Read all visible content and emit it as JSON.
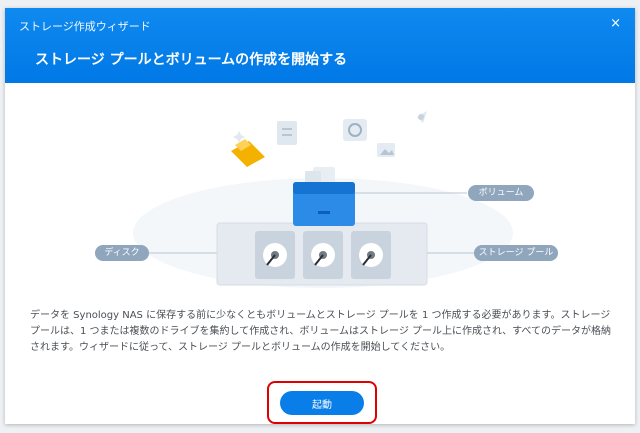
{
  "window": {
    "title": "ストレージ作成ウィザード",
    "close_symbol": "×"
  },
  "header": {
    "page_title": "ストレージ プールとボリュームの作成を開始する"
  },
  "illustration": {
    "labels": {
      "volume": "ボリューム",
      "disk": "ディスク",
      "storage_pool": "ストレージ プール"
    }
  },
  "description": "データを Synology NAS に保存する前に少なくともボリュームとストレージ プールを 1 つ作成する必要があります。ストレージ プールは、1 つまたは複数のドライブを集約して作成され、ボリュームはストレージ プール上に作成され、すべてのデータが格納されます。ウィザードに従って、ストレージ プールとボリュームの作成を開始してください。",
  "buttons": {
    "start": "起動"
  },
  "colors": {
    "header": "#0078e6",
    "button": "#0a7ee8",
    "highlight": "#e00000",
    "pill": "#8fa6bd"
  }
}
